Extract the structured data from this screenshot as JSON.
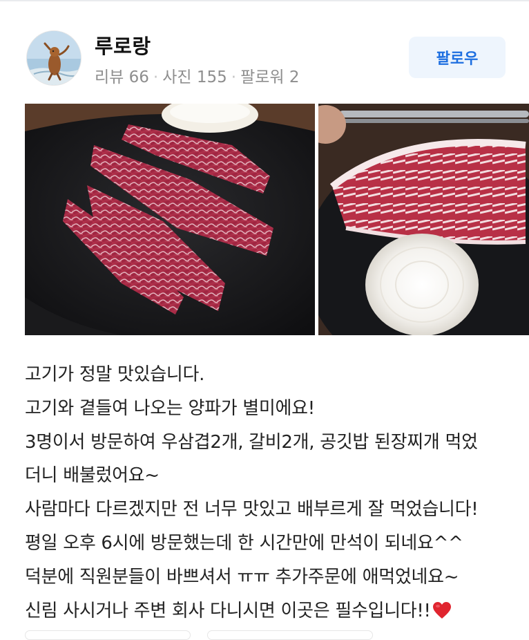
{
  "author": {
    "name": "루로랑",
    "stats": [
      {
        "label": "리뷰",
        "value": "66"
      },
      {
        "label": "사진",
        "value": "155"
      },
      {
        "label": "팔로워",
        "value": "2"
      }
    ]
  },
  "follow_button": {
    "label": "팔로우"
  },
  "review_lines": [
    "고기가 정말 맛있습니다.",
    "고기와 곁들여 나오는 양파가 별미에요!",
    "3명이서 방문하여 우삼겹2개, 갈비2개, 공깃밥 된장찌개 먹었",
    "더니 배불렀어요~",
    "사람마다 다르겠지만 전 너무 맛있고 배부르게 잘 먹었습니다!",
    "평일 오후 6시에 방문했는데 한 시간만에 만석이 되네요^^",
    "덕분에 직원분들이 바쁘셔서 ㅠㅠ 추가주문에 애먹었네요~",
    "신림 사시거나 주변 회사 다니시면 이곳은 필수입니다!!"
  ],
  "icons": {
    "avatar": "otter-avatar-icon",
    "heart": "red-heart-emoji"
  },
  "colors": {
    "follow_text": "#1e6fe0",
    "follow_bg": "#eef5fd",
    "stats_text": "#8e8e8e",
    "heart": "#e0252f"
  }
}
